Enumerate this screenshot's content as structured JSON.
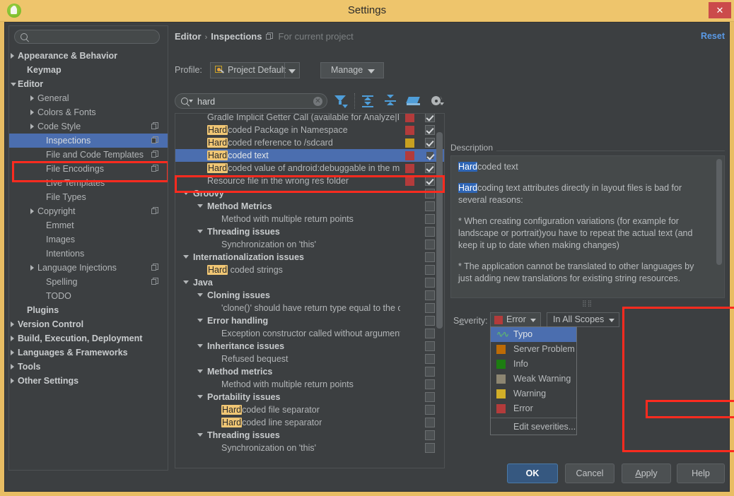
{
  "window": {
    "title": "Settings",
    "icon": "android-studio-icon",
    "close_label": "✕"
  },
  "sidebar": {
    "search_placeholder": "",
    "search_value": "",
    "search_icon": "search-icon",
    "items": [
      {
        "label": "Appearance & Behavior",
        "indent": 12,
        "arrow": "closed",
        "bold": true,
        "badge": false,
        "selected": false
      },
      {
        "label": "Keymap",
        "indent": 25,
        "arrow": "none",
        "bold": true,
        "badge": false,
        "selected": false
      },
      {
        "label": "Editor",
        "indent": 12,
        "arrow": "open",
        "bold": true,
        "badge": false,
        "selected": false
      },
      {
        "label": "General",
        "indent": 40,
        "arrow": "closed",
        "bold": false,
        "badge": false,
        "selected": false
      },
      {
        "label": "Colors & Fonts",
        "indent": 40,
        "arrow": "closed",
        "bold": false,
        "badge": false,
        "selected": false
      },
      {
        "label": "Code Style",
        "indent": 40,
        "arrow": "closed",
        "bold": false,
        "badge": true,
        "selected": false
      },
      {
        "label": "Inspections",
        "indent": 52,
        "arrow": "none",
        "bold": false,
        "badge": true,
        "selected": true
      },
      {
        "label": "File and Code Templates",
        "indent": 52,
        "arrow": "none",
        "bold": false,
        "badge": true,
        "selected": false
      },
      {
        "label": "File Encodings",
        "indent": 52,
        "arrow": "none",
        "bold": false,
        "badge": true,
        "selected": false
      },
      {
        "label": "Live Templates",
        "indent": 52,
        "arrow": "none",
        "bold": false,
        "badge": false,
        "selected": false
      },
      {
        "label": "File Types",
        "indent": 52,
        "arrow": "none",
        "bold": false,
        "badge": false,
        "selected": false
      },
      {
        "label": "Copyright",
        "indent": 40,
        "arrow": "closed",
        "bold": false,
        "badge": true,
        "selected": false
      },
      {
        "label": "Emmet",
        "indent": 52,
        "arrow": "none",
        "bold": false,
        "badge": false,
        "selected": false
      },
      {
        "label": "Images",
        "indent": 52,
        "arrow": "none",
        "bold": false,
        "badge": false,
        "selected": false
      },
      {
        "label": "Intentions",
        "indent": 52,
        "arrow": "none",
        "bold": false,
        "badge": false,
        "selected": false
      },
      {
        "label": "Language Injections",
        "indent": 40,
        "arrow": "closed",
        "bold": false,
        "badge": true,
        "selected": false
      },
      {
        "label": "Spelling",
        "indent": 52,
        "arrow": "none",
        "bold": false,
        "badge": true,
        "selected": false
      },
      {
        "label": "TODO",
        "indent": 52,
        "arrow": "none",
        "bold": false,
        "badge": false,
        "selected": false
      },
      {
        "label": "Plugins",
        "indent": 25,
        "arrow": "none",
        "bold": true,
        "badge": false,
        "selected": false
      },
      {
        "label": "Version Control",
        "indent": 12,
        "arrow": "closed",
        "bold": true,
        "badge": false,
        "selected": false
      },
      {
        "label": "Build, Execution, Deployment",
        "indent": 12,
        "arrow": "closed",
        "bold": true,
        "badge": false,
        "selected": false
      },
      {
        "label": "Languages & Frameworks",
        "indent": 12,
        "arrow": "closed",
        "bold": true,
        "badge": false,
        "selected": false
      },
      {
        "label": "Tools",
        "indent": 12,
        "arrow": "closed",
        "bold": true,
        "badge": false,
        "selected": false
      },
      {
        "label": "Other Settings",
        "indent": 12,
        "arrow": "closed",
        "bold": true,
        "badge": false,
        "selected": false
      }
    ]
  },
  "header": {
    "breadcrumb_first": "Editor",
    "breadcrumb_sep": "›",
    "breadcrumb_second": "Inspections",
    "scope_note": "For current project",
    "scope_note_icon": "project-scope-icon",
    "reset_label": "Reset"
  },
  "profile": {
    "label": "Profile:",
    "value": "Project Default",
    "icon": "profile-icon",
    "manage_label": "Manage"
  },
  "search": {
    "value": "hard",
    "placeholder": "",
    "search_icon": "search-icon",
    "clear_icon": "clear-icon",
    "toolbar": [
      {
        "name": "filter-icon",
        "title": "Filter inspections"
      },
      {
        "name": "expand-all-icon",
        "title": "Expand all"
      },
      {
        "name": "collapse-all-icon",
        "title": "Collapse all"
      },
      {
        "name": "reset-to-empty-icon",
        "title": "Reset to Empty"
      },
      {
        "name": "gear-icon",
        "title": "Options"
      }
    ]
  },
  "inspections": [
    {
      "label": "Gradle Implicit Getter Call (available for Analyze|In",
      "indent": 45,
      "arrow": "none",
      "group": false,
      "highlight": "",
      "severity": "#b33b3b",
      "checkbox": "checked",
      "selected": false
    },
    {
      "label": "coded Package in Namespace",
      "indent": 45,
      "arrow": "none",
      "group": false,
      "highlight": "Hard",
      "severity": "#b33b3b",
      "checkbox": "checked",
      "selected": false
    },
    {
      "label": "coded reference to /sdcard",
      "indent": 45,
      "arrow": "none",
      "group": false,
      "highlight": "Hard",
      "severity": "#c8a020",
      "checkbox": "checked",
      "selected": false
    },
    {
      "label": "coded text",
      "indent": 45,
      "arrow": "none",
      "group": false,
      "highlight": "Hard",
      "severity": "#b33b3b",
      "checkbox": "checked-focus",
      "selected": true
    },
    {
      "label": "coded value of android:debuggable in the m",
      "indent": 45,
      "arrow": "none",
      "group": false,
      "highlight": "Hard",
      "severity": "#b33b3b",
      "checkbox": "checked",
      "selected": false
    },
    {
      "label": "Resource file in the wrong res folder",
      "indent": 45,
      "arrow": "none",
      "group": false,
      "highlight": "",
      "severity": "#b33b3b",
      "checkbox": "checked",
      "selected": false
    },
    {
      "label": "Groovy",
      "indent": 25,
      "arrow": "open",
      "group": true,
      "highlight": "",
      "severity": "",
      "checkbox": "empty",
      "selected": false
    },
    {
      "label": "Method Metrics",
      "indent": 45,
      "arrow": "open",
      "group": true,
      "highlight": "",
      "severity": "",
      "checkbox": "empty",
      "selected": false
    },
    {
      "label": "Method with multiple return points",
      "indent": 65,
      "arrow": "none",
      "group": false,
      "highlight": "",
      "severity": "",
      "checkbox": "empty",
      "selected": false
    },
    {
      "label": "Threading issues",
      "indent": 45,
      "arrow": "open",
      "group": true,
      "highlight": "",
      "severity": "",
      "checkbox": "empty",
      "selected": false
    },
    {
      "label": "Synchronization on 'this'",
      "indent": 65,
      "arrow": "none",
      "group": false,
      "highlight": "",
      "severity": "",
      "checkbox": "empty",
      "selected": false
    },
    {
      "label": "Internationalization issues",
      "indent": 25,
      "arrow": "open",
      "group": true,
      "highlight": "",
      "severity": "",
      "checkbox": "empty",
      "selected": false
    },
    {
      "label": " coded strings",
      "indent": 45,
      "arrow": "none",
      "group": false,
      "highlight": "Hard",
      "severity": "",
      "checkbox": "empty",
      "selected": false
    },
    {
      "label": "Java",
      "indent": 25,
      "arrow": "open",
      "group": true,
      "highlight": "",
      "severity": "",
      "checkbox": "empty",
      "selected": false
    },
    {
      "label": "Cloning issues",
      "indent": 45,
      "arrow": "open",
      "group": true,
      "highlight": "",
      "severity": "",
      "checkbox": "empty",
      "selected": false
    },
    {
      "label": "'clone()' should have return type equal to the c",
      "indent": 65,
      "arrow": "none",
      "group": false,
      "highlight": "",
      "severity": "",
      "checkbox": "empty",
      "selected": false
    },
    {
      "label": "Error handling",
      "indent": 45,
      "arrow": "open",
      "group": true,
      "highlight": "",
      "severity": "",
      "checkbox": "empty",
      "selected": false
    },
    {
      "label": "Exception constructor called without argument",
      "indent": 65,
      "arrow": "none",
      "group": false,
      "highlight": "",
      "severity": "",
      "checkbox": "empty",
      "selected": false
    },
    {
      "label": "Inheritance issues",
      "indent": 45,
      "arrow": "open",
      "group": true,
      "highlight": "",
      "severity": "",
      "checkbox": "empty",
      "selected": false
    },
    {
      "label": "Refused bequest",
      "indent": 65,
      "arrow": "none",
      "group": false,
      "highlight": "",
      "severity": "",
      "checkbox": "empty",
      "selected": false
    },
    {
      "label": "Method metrics",
      "indent": 45,
      "arrow": "open",
      "group": true,
      "highlight": "",
      "severity": "",
      "checkbox": "empty",
      "selected": false
    },
    {
      "label": "Method with multiple return points",
      "indent": 65,
      "arrow": "none",
      "group": false,
      "highlight": "",
      "severity": "",
      "checkbox": "empty",
      "selected": false
    },
    {
      "label": "Portability issues",
      "indent": 45,
      "arrow": "open",
      "group": true,
      "highlight": "",
      "severity": "",
      "checkbox": "empty",
      "selected": false
    },
    {
      "label": "coded file separator",
      "indent": 65,
      "arrow": "none",
      "group": false,
      "highlight": "Hard",
      "severity": "",
      "checkbox": "empty",
      "selected": false
    },
    {
      "label": "coded line separator",
      "indent": 65,
      "arrow": "none",
      "group": false,
      "highlight": "Hard",
      "severity": "",
      "checkbox": "empty",
      "selected": false
    },
    {
      "label": "Threading issues",
      "indent": 45,
      "arrow": "open",
      "group": true,
      "highlight": "",
      "severity": "",
      "checkbox": "empty",
      "selected": false
    },
    {
      "label": "Synchronization on 'this'",
      "indent": 65,
      "arrow": "none",
      "group": false,
      "highlight": "",
      "severity": "",
      "checkbox": "empty",
      "selected": false
    }
  ],
  "description": {
    "title": "Description",
    "heading_highlight": "Hard",
    "heading_rest": "coded text",
    "p1_highlight": "Hard",
    "p1_rest": "coding text attributes directly in layout files is bad for several reasons:",
    "p2": "* When creating configuration variations (for example for landscape or portrait)you have to repeat the actual text (and keep it up to date when making changes)",
    "p3": "* The application cannot be translated to other languages by just adding new translations for existing string resources."
  },
  "severity": {
    "label": "Severity:",
    "label_accel": "e",
    "selected": "Error",
    "selected_color": "#b33b3b",
    "scope": "In All Scopes",
    "menu": [
      {
        "label": "Typo",
        "color": "",
        "icon": "typo-icon",
        "selected": true
      },
      {
        "label": "Server Problem",
        "color": "#bd6b06",
        "icon": "",
        "selected": false
      },
      {
        "label": "Info",
        "color": "#1d7d11",
        "icon": "",
        "selected": false
      },
      {
        "label": "Weak Warning",
        "color": "#8d8672",
        "icon": "",
        "selected": false
      },
      {
        "label": "Warning",
        "color": "#d1ae28",
        "icon": "",
        "selected": false
      },
      {
        "label": "Error",
        "color": "#b33b3b",
        "icon": "",
        "selected": false
      }
    ],
    "edit_label": "Edit severities..."
  },
  "buttons": {
    "ok": "OK",
    "cancel": "Cancel",
    "apply": "Apply",
    "apply_accel": "A",
    "help": "Help"
  },
  "colors": {
    "accent_selection": "#4b6eaf",
    "highlight_box": "#ff2b1f",
    "titlebar": "#eec56c",
    "panel_bg": "#3c3f41",
    "field_bg": "#45494a",
    "link": "#5a9ae6"
  }
}
